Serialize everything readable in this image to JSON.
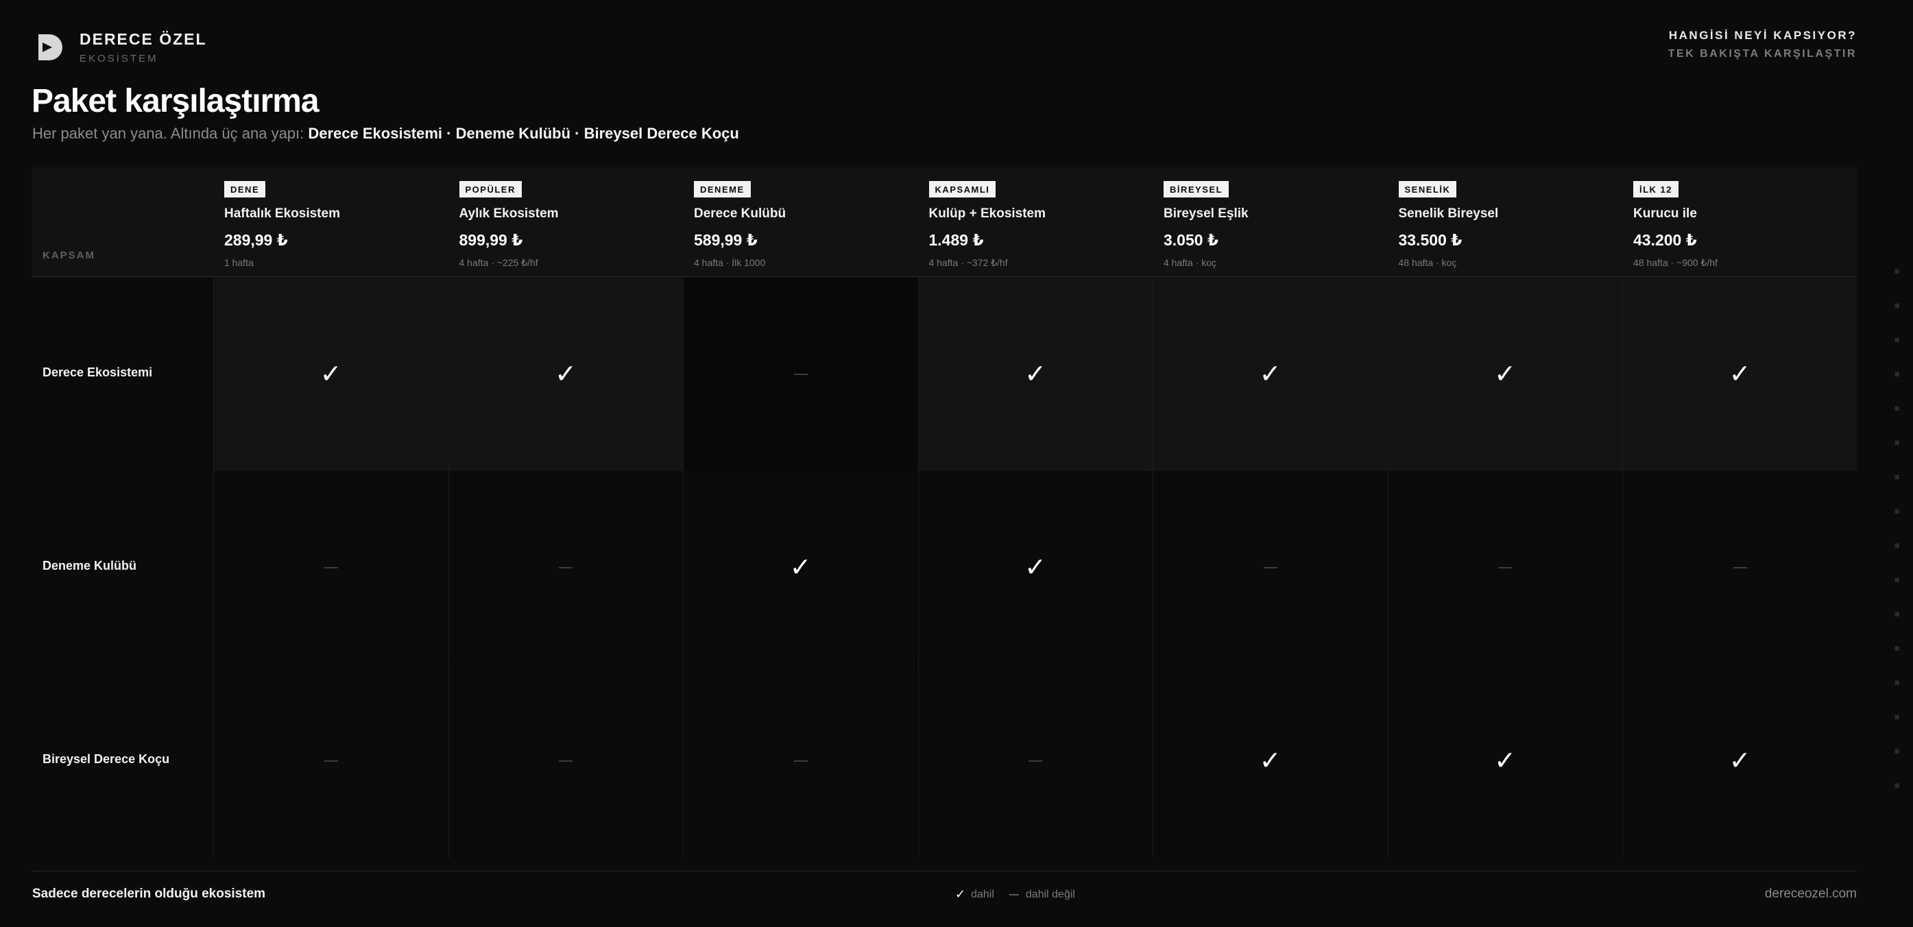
{
  "brand": {
    "name": "DERECE ÖZEL",
    "sub": "EKOSİSTEM"
  },
  "top_right": {
    "question": "HANGİSİ NEYİ KAPSIYOR?",
    "sub": "TEK BAKIŞTA KARŞILAŞTIR"
  },
  "title": "Paket karşılaştırma",
  "subtitle": {
    "lead": "Her paket yan yana. Altında üç ana yapı: ",
    "bold": "Derece Ekosistemi · Deneme Kulübü · Bireysel Derece Koçu"
  },
  "table": {
    "corner_label": "KAPSAM",
    "packages": [
      {
        "badge": "DENE",
        "name": "Haftalık Ekosistem",
        "price": "289,99 ₺",
        "period": "1 hafta"
      },
      {
        "badge": "POPÜLER",
        "name": "Aylık Ekosistem",
        "price": "899,99 ₺",
        "period": "4 hafta · ~225 ₺/hf"
      },
      {
        "badge": "DENEME",
        "name": "Derece Kulübü",
        "price": "589,99 ₺",
        "period": "4 hafta · İlk 1000"
      },
      {
        "badge": "KAPSAMLI",
        "name": "Kulüp + Ekosistem",
        "price": "1.489 ₺",
        "period": "4 hafta · ~372 ₺/hf"
      },
      {
        "badge": "BİREYSEL",
        "name": "Bireysel Eşlik",
        "price": "3.050 ₺",
        "period": "4 hafta · koç"
      },
      {
        "badge": "SENELİK",
        "name": "Senelik Bireysel",
        "price": "33.500 ₺",
        "period": "48 hafta · koç"
      },
      {
        "badge": "İLK 12",
        "name": "Kurucu ile",
        "price": "43.200 ₺",
        "period": "48 hafta · ~900 ₺/hf"
      }
    ],
    "rows": [
      {
        "label": "Derece Ekosistemi",
        "included": [
          true,
          true,
          false,
          true,
          true,
          true,
          true
        ]
      },
      {
        "label": "Deneme Kulübü",
        "included": [
          false,
          false,
          true,
          true,
          false,
          false,
          false
        ]
      },
      {
        "label": "Bireysel Derece Koçu",
        "included": [
          false,
          false,
          false,
          false,
          true,
          true,
          true
        ]
      }
    ],
    "check_glyph": "✓"
  },
  "footer": {
    "left": "Sadece derecelerin olduğu ekosistem",
    "legend_included": "dahil",
    "legend_excluded": "dahil değil",
    "right": "dereceozel.com"
  },
  "colors": {
    "background": "#0b0b0b",
    "header_bg": "#121212",
    "text": "#f2f2f2",
    "muted": "#7a7a7a"
  }
}
